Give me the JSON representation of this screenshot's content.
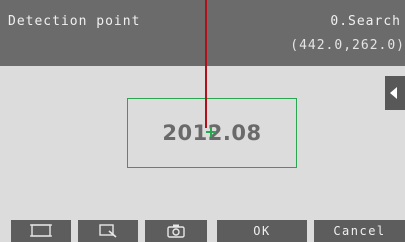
{
  "header": {
    "title": "Detection point",
    "mode": "0.Search",
    "coordinates": "(442.0,262.0)"
  },
  "viewer": {
    "detected_value": "2012.08"
  },
  "toolbar": {
    "frame_icon": "frame-icon",
    "zoom_icon": "zoom-icon",
    "camera_icon": "camera-icon",
    "ok_label": "OK",
    "cancel_label": "Cancel"
  },
  "colors": {
    "header_bg": "#6b6b6b",
    "viewer_bg": "#dcdcdc",
    "detection_box": "#2aa650",
    "leader_line": "#b0101a",
    "button_bg": "#5d5d5d"
  }
}
